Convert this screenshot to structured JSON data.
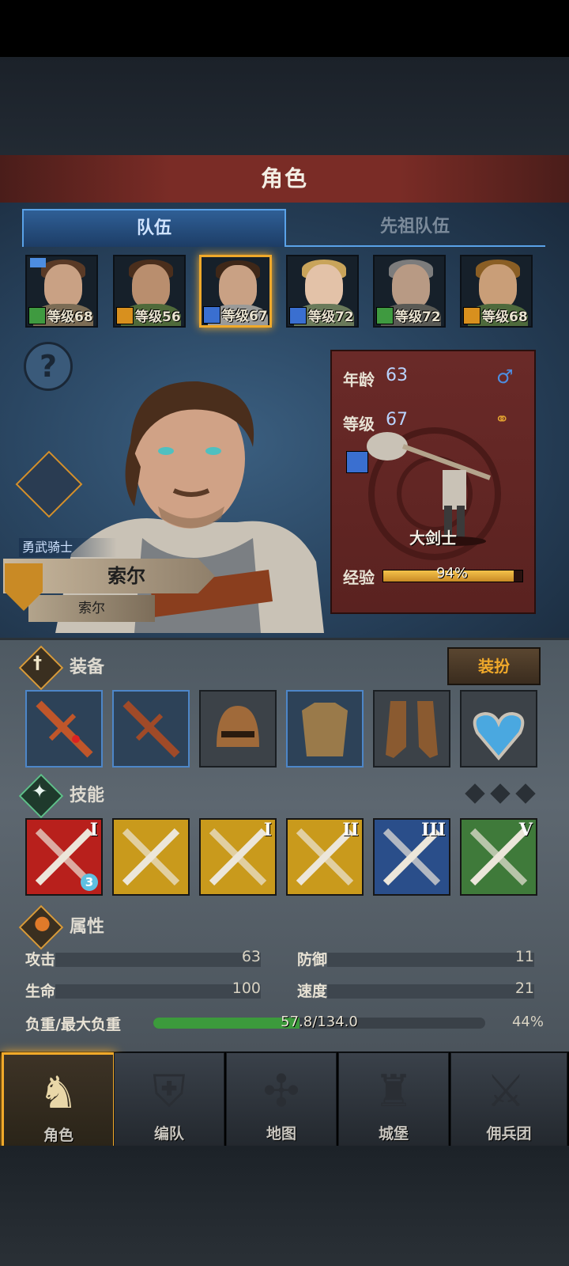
{
  "header": {
    "title": "角色"
  },
  "tabs": [
    {
      "label": "队伍",
      "active": true
    },
    {
      "label": "先祖队伍",
      "active": false
    }
  ],
  "party": [
    {
      "level_label": "等级68",
      "class_icon": "green-crossed-icon",
      "flag": true,
      "selected": false
    },
    {
      "level_label": "等级56",
      "class_icon": "orange-shield-icon",
      "flag": false,
      "selected": false
    },
    {
      "level_label": "等级67",
      "class_icon": "blue-sword-icon",
      "flag": false,
      "selected": true
    },
    {
      "level_label": "等级72",
      "class_icon": "blue-sword-icon",
      "flag": false,
      "selected": false
    },
    {
      "level_label": "等级72",
      "class_icon": "green-crossed-icon",
      "flag": false,
      "selected": false
    },
    {
      "level_label": "等级68",
      "class_icon": "orange-shield-icon",
      "flag": false,
      "selected": false
    }
  ],
  "character": {
    "title": "勇武骑士",
    "name": "索尔",
    "subname": "索尔",
    "age_label": "年龄",
    "age": "63",
    "level_label": "等级",
    "level": "67",
    "class_name": "大剑士",
    "exp_label": "经验",
    "exp_percent_text": "94%",
    "exp_fraction": 0.94
  },
  "equipment": {
    "header": "装备",
    "outfit_button": "装扮",
    "slots": [
      "weapon-sword-icon",
      "weapon-sword-icon",
      "helmet-icon",
      "armor-icon",
      "boots-icon",
      "amulet-icon"
    ]
  },
  "skills": {
    "header": "技能",
    "items": [
      {
        "icon": "sword-strike-icon",
        "rank": "I",
        "color": "#b8201c",
        "badge": "3"
      },
      {
        "icon": "aura-icon",
        "rank": "",
        "color": "#c99a1c",
        "badge": ""
      },
      {
        "icon": "target-slash-icon",
        "rank": "I",
        "color": "#c99a1c",
        "badge": ""
      },
      {
        "icon": "cross-swords-icon",
        "rank": "II",
        "color": "#c99a1c",
        "badge": ""
      },
      {
        "icon": "cross-swords-icon",
        "rank": "III",
        "color": "#2a4e8a",
        "badge": ""
      },
      {
        "icon": "burst-icon",
        "rank": "V",
        "color": "#3f7a3a",
        "badge": ""
      }
    ]
  },
  "attributes": {
    "header": "属性",
    "attack_label": "攻击",
    "attack": "63",
    "defense_label": "防御",
    "defense": "11",
    "hp_label": "生命",
    "hp": "100",
    "speed_label": "速度",
    "speed": "21",
    "load_label": "负重/最大负重",
    "load_value": "57.8/134.0",
    "load_percent": "44%",
    "load_fraction": 0.44
  },
  "nav": [
    {
      "label": "角色",
      "icon": "knight-icon",
      "active": true
    },
    {
      "label": "编队",
      "icon": "helmet-formation-icon",
      "active": false
    },
    {
      "label": "地图",
      "icon": "compass-map-icon",
      "active": false
    },
    {
      "label": "城堡",
      "icon": "castle-icon",
      "active": false
    },
    {
      "label": "佣兵团",
      "icon": "mercenary-icon",
      "active": false
    }
  ]
}
